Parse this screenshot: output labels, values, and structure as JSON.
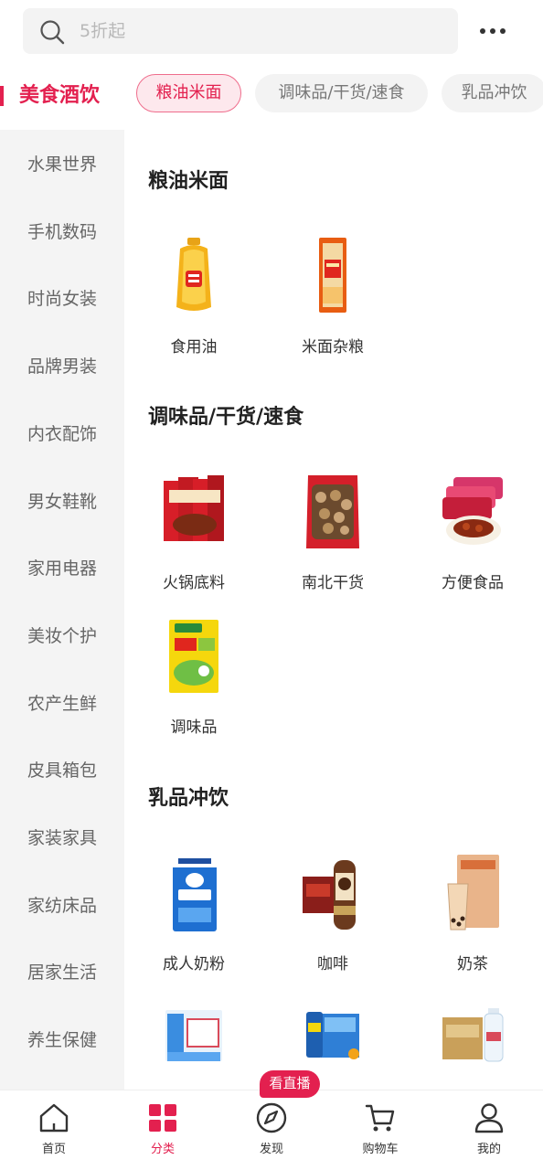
{
  "search": {
    "placeholder": "5折起"
  },
  "top_category": {
    "active_label": "美食酒饮",
    "chips": [
      "粮油米面",
      "调味品/干货/速食",
      "乳品冲饮"
    ]
  },
  "sidebar": {
    "items": [
      "水果世界",
      "手机数码",
      "时尚女装",
      "品牌男装",
      "内衣配饰",
      "男女鞋靴",
      "家用电器",
      "美妆个护",
      "农产生鲜",
      "皮具箱包",
      "家装家具",
      "家纺床品",
      "居家生活",
      "养生保健"
    ]
  },
  "sections": [
    {
      "title": "粮油米面",
      "items": [
        "食用油",
        "米面杂粮"
      ]
    },
    {
      "title": "调味品/干货/速食",
      "items": [
        "火锅底料",
        "南北干货",
        "方便食品",
        "调味品"
      ]
    },
    {
      "title": "乳品冲饮",
      "items": [
        "成人奶粉",
        "咖啡",
        "奶茶"
      ]
    }
  ],
  "bottom_nav": {
    "live_badge": "看直播",
    "items": [
      {
        "label": "首页",
        "icon": "home-icon"
      },
      {
        "label": "分类",
        "icon": "category-grid-icon"
      },
      {
        "label": "发现",
        "icon": "compass-icon"
      },
      {
        "label": "购物车",
        "icon": "cart-icon"
      },
      {
        "label": "我的",
        "icon": "profile-icon"
      }
    ]
  },
  "colors": {
    "accent": "#e3204f",
    "sidebar_bg": "#f4f4f4",
    "chip_bg": "#f3f3f3"
  }
}
